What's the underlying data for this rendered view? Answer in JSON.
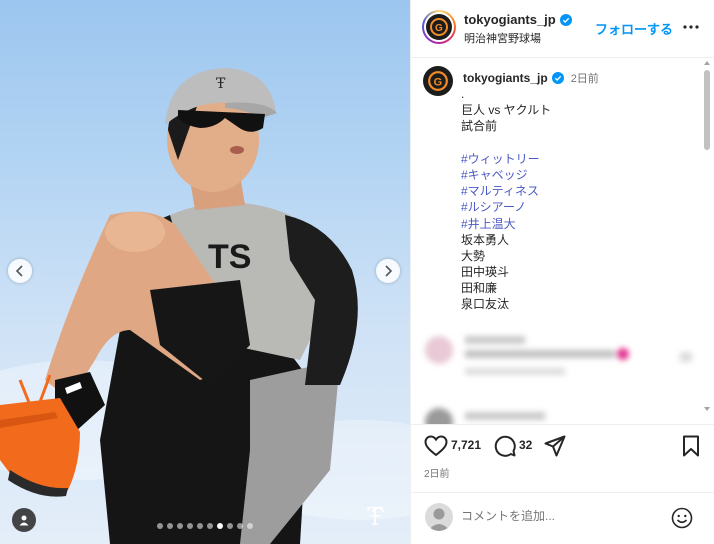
{
  "account": {
    "username": "tokyogiants_jp",
    "location": "明治神宮野球場",
    "follow_label": "フォローする",
    "verified_icon": "verified-badge-icon"
  },
  "caption": {
    "username": "tokyogiants_jp",
    "time": "2日前",
    "lines": [
      {
        "text": ".",
        "type": "text"
      },
      {
        "text": "巨人 vs ヤクルト",
        "type": "text"
      },
      {
        "text": "試合前",
        "type": "text"
      },
      {
        "text": "",
        "type": "text"
      },
      {
        "text": "#ウィットリー",
        "type": "tag"
      },
      {
        "text": "#キャベッジ",
        "type": "tag"
      },
      {
        "text": "#マルティネス",
        "type": "tag"
      },
      {
        "text": "#ルシアーノ",
        "type": "tag"
      },
      {
        "text": "#井上温大",
        "type": "tag"
      },
      {
        "text": "坂本勇人",
        "type": "text"
      },
      {
        "text": "大勢",
        "type": "text"
      },
      {
        "text": "田中瑛斗",
        "type": "text"
      },
      {
        "text": "田和廉",
        "type": "text"
      },
      {
        "text": "泉口友汰",
        "type": "text"
      }
    ]
  },
  "media": {
    "carousel_count": 10,
    "active_index": 6,
    "jersey_text": "TS"
  },
  "actions": {
    "likes": "7,721",
    "comments": "32",
    "time": "2日前"
  },
  "comment_box": {
    "placeholder": "コメントを追加..."
  },
  "colors": {
    "accent": "#0095f6",
    "hashtag": "#4a59c4",
    "verified": "#0095f6",
    "shoe_orange": "#f26b1d"
  }
}
